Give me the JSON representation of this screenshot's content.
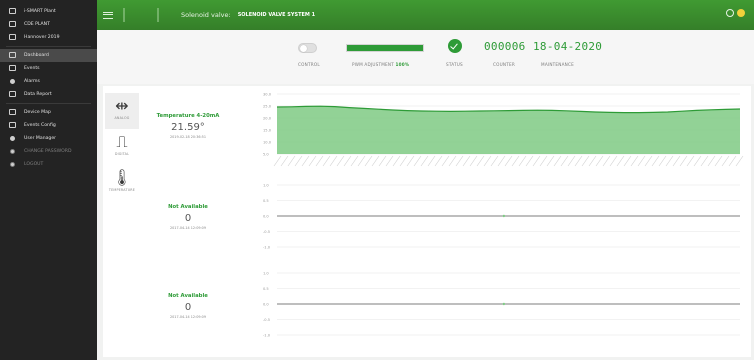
{
  "sidebar": {
    "items": [
      {
        "label": "i-SMART Plant",
        "active": false,
        "muted": false,
        "icon": "monitor-icon"
      },
      {
        "label": "CDE PLANT",
        "active": false,
        "muted": false,
        "icon": "monitor-icon"
      },
      {
        "label": "Hannover 2019",
        "active": false,
        "muted": false,
        "icon": "monitor-icon"
      },
      {
        "label": "Dashboard",
        "active": true,
        "muted": false,
        "icon": "dashboard-icon"
      },
      {
        "label": "Events",
        "active": false,
        "muted": false,
        "icon": "calendar-icon"
      },
      {
        "label": "Alarms",
        "active": false,
        "muted": false,
        "icon": "alarm-icon"
      },
      {
        "label": "Data Report",
        "active": false,
        "muted": false,
        "icon": "chart-icon"
      },
      {
        "label": "Device Map",
        "active": false,
        "muted": false,
        "icon": "map-icon"
      },
      {
        "label": "Events Config",
        "active": false,
        "muted": false,
        "icon": "calendar-icon"
      },
      {
        "label": "User Manager",
        "active": false,
        "muted": false,
        "icon": "user-icon"
      },
      {
        "label": "CHANGE PASSWORD",
        "active": false,
        "muted": true,
        "icon": "key-icon"
      },
      {
        "label": "LOGOUT",
        "active": false,
        "muted": true,
        "icon": "logout-icon"
      }
    ]
  },
  "topbar": {
    "valve_label": "Solenoid valve:",
    "valve_name": "SOLENOID VALVE SYSTEM 1"
  },
  "status": {
    "control_label": "CONTROL",
    "pwm_label": "PWM ADJUSTMENT",
    "pwm_value": "100%",
    "pwm_fraction": 1.0,
    "status_label": "STATUS",
    "counter_value": "000006",
    "counter_label": "COUNTER",
    "maintenance_value": "18-04-2020",
    "maintenance_label": "MAINTENANCE"
  },
  "tabs": [
    {
      "label": "ANALOG",
      "icon": "analog-icon",
      "active": true
    },
    {
      "label": "DIGITAL",
      "icon": "digital-pulse-icon",
      "active": false
    },
    {
      "label": "TEMPERATURE",
      "icon": "thermometer-icon",
      "active": false
    }
  ],
  "sensors": [
    {
      "name": "Temperature 4-20mA",
      "value": "21.59°",
      "time": "2019-02-18 20:36:51"
    },
    {
      "name": "Not Available",
      "value": "0",
      "time": "2017-04-14 12:09:09"
    },
    {
      "name": "Not Available",
      "value": "0",
      "time": "2017-04-14 12:09:09"
    }
  ],
  "chart_data": [
    {
      "type": "area",
      "y_ticks": [
        "30.0",
        "25.0",
        "20.0",
        "15.0",
        "10.0",
        "5.0"
      ],
      "ylim": [
        0,
        30
      ],
      "values": [
        23.5,
        23.6,
        23.8,
        23.9,
        23.7,
        23.2,
        22.8,
        22.4,
        22.0,
        21.7,
        21.5,
        21.4,
        21.3,
        21.4,
        21.5,
        21.6,
        21.7,
        21.8,
        21.9,
        21.8,
        21.6,
        21.3,
        21.0,
        20.8,
        20.7,
        20.7,
        20.8,
        21.0,
        21.4,
        21.8,
        22.1,
        22.3,
        22.5
      ],
      "color": "#2e9b37"
    },
    {
      "type": "line",
      "y_ticks": [
        "1.0",
        "0.5",
        "0.0",
        "-0.5",
        "-1.0"
      ],
      "ylim": [
        -1,
        1
      ],
      "values": [
        0,
        0
      ],
      "color": "#555555"
    },
    {
      "type": "line",
      "y_ticks": [
        "1.0",
        "0.5",
        "0.0",
        "-0.5",
        "-1.0"
      ],
      "ylim": [
        -1,
        1
      ],
      "values": [
        0,
        0
      ],
      "color": "#555555"
    }
  ]
}
